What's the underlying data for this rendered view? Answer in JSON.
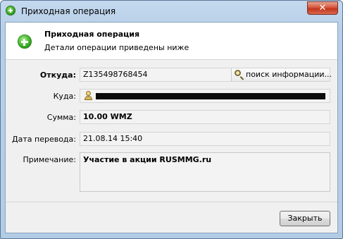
{
  "window": {
    "title": "Приходная операция"
  },
  "header": {
    "title": "Приходная операция",
    "subtitle": "Детали операции приведены ниже"
  },
  "form": {
    "from": {
      "label": "Откуда:",
      "value": "Z135498768454",
      "search_label": "поиск информации..."
    },
    "to": {
      "label": "Куда:",
      "value": ""
    },
    "amount": {
      "label": "Сумма:",
      "value": "10.00 WMZ"
    },
    "date": {
      "label": "Дата перевода:",
      "value": "21.08.14 15:40"
    },
    "note": {
      "label": "Примечание:",
      "value": "Участие в акции RUSMMG.ru"
    }
  },
  "footer": {
    "close_label": "Закрыть"
  },
  "icons": {
    "window": "plus-circle-icon",
    "header": "plus-circle-icon",
    "search": "magnifier-icon",
    "recipient": "person-icon",
    "close": "close-icon"
  },
  "colors": {
    "accent_green": "#34a523",
    "close_red": "#c2361e"
  }
}
